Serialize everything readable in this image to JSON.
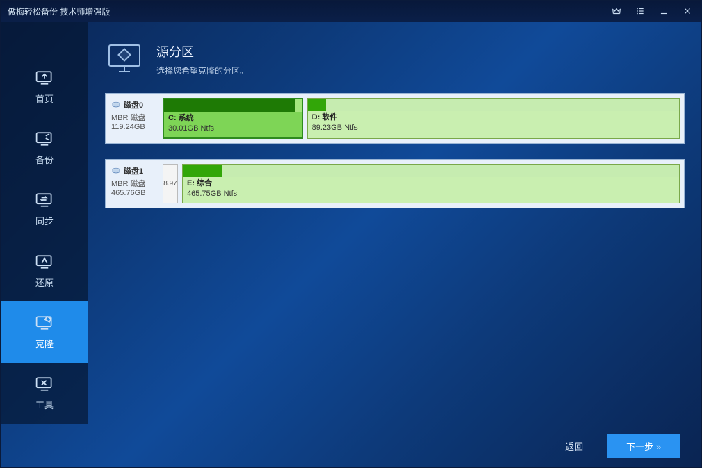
{
  "titlebar": {
    "title": "傲梅轻松备份 技术师增强版"
  },
  "sidebar": {
    "items": [
      {
        "label": "首页",
        "icon": "home"
      },
      {
        "label": "备份",
        "icon": "backup"
      },
      {
        "label": "同步",
        "icon": "sync"
      },
      {
        "label": "还原",
        "icon": "restore"
      },
      {
        "label": "克隆",
        "icon": "clone",
        "active": true
      },
      {
        "label": "工具",
        "icon": "tools"
      }
    ]
  },
  "header": {
    "title": "源分区",
    "subtitle": "选择您希望克隆的分区。"
  },
  "disks": [
    {
      "name": "磁盘0",
      "type": "MBR 磁盘",
      "size": "119.24GB",
      "partitions": [
        {
          "name": "C: 系统",
          "sizeLine": "30.01GB Ntfs",
          "widthPct": 27,
          "usedPct": 95,
          "selected": true
        },
        {
          "name": "D: 软件",
          "sizeLine": "89.23GB Ntfs",
          "widthPct": 73,
          "usedPct": 5,
          "selected": false
        }
      ]
    },
    {
      "name": "磁盘1",
      "type": "MBR 磁盘",
      "size": "465.76GB",
      "tiny": {
        "label": "8.97",
        "widthPx": 22
      },
      "partitions": [
        {
          "name": "E: 综合",
          "sizeLine": "465.75GB Ntfs",
          "widthPct": 100,
          "usedPct": 8,
          "selected": false
        }
      ]
    }
  ],
  "footer": {
    "back": "返回",
    "next": "下一步 »"
  }
}
